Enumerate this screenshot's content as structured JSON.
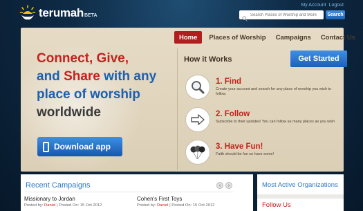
{
  "header": {
    "logo_text": "terumah",
    "logo_badge": "BETA",
    "my_account": "My Account",
    "logout": "Logout",
    "search_placeholder": "Search Places of Worship and More",
    "search_button": "Search"
  },
  "nav": {
    "items": [
      "Home",
      "Places of Worship",
      "Campaigns",
      "Contact Us"
    ],
    "active": "Home"
  },
  "hero": {
    "line1_red": "Connect, Give,",
    "line2_blue_a": "and",
    "line2_red": "Share",
    "line2_blue_b": "with any",
    "line3_blue": "place of worship",
    "line4_dark": "worldwide",
    "download_button": "Download app"
  },
  "how": {
    "title": "How it Works",
    "get_started": "Get Started",
    "steps": [
      {
        "title": "1. Find",
        "desc": "Create your account and search for any place of worship you wish to follow.",
        "icon": "magnifier-icon"
      },
      {
        "title": "2. Follow",
        "desc": "Subscribe to their updates! You can follow as many places as you wish",
        "icon": "arrow-right-icon"
      },
      {
        "title": "3. Have Fun!",
        "desc": "Faith should be fun so have some!",
        "icon": "balloons-icon"
      }
    ]
  },
  "campaigns": {
    "title": "Recent Campaigns",
    "items": [
      {
        "name": "Missionary to Jordan",
        "posted_by_label": "Posted by:",
        "author": "Daniel",
        "posted_on": "| Posted On: 15 Oct 2012"
      },
      {
        "name": "Cohen's First Toys",
        "posted_by_label": "Posted by:",
        "author": "Daniel",
        "posted_on": "| Posted On: 15 Oct 2012"
      }
    ],
    "prev_symbol": "‹",
    "next_symbol": "›"
  },
  "sidebar": {
    "most_active": "Most Active Organizations",
    "follow_us": "Follow Us"
  },
  "colors": {
    "accent_red": "#c4221e",
    "accent_blue": "#1d5fb0",
    "link_blue": "#2a7ac9"
  }
}
